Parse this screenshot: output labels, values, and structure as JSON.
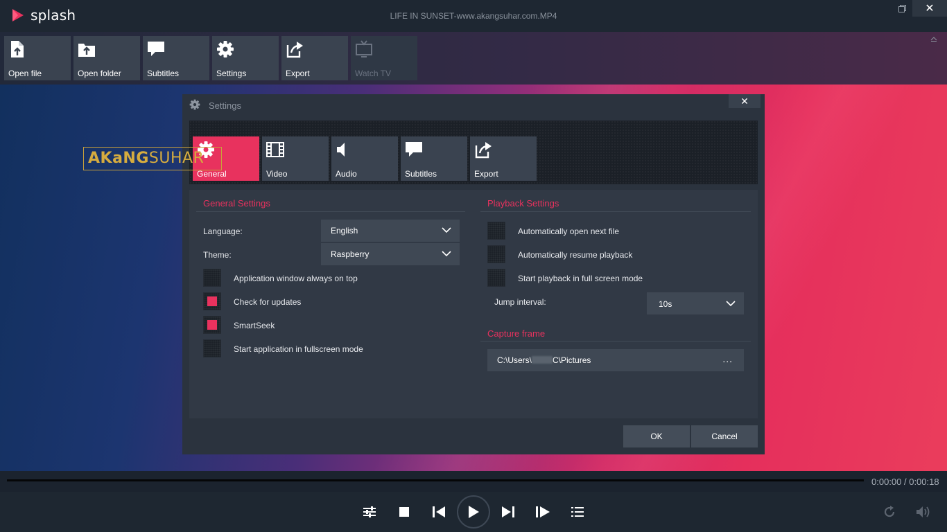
{
  "app": {
    "name": "splash",
    "file_title": "LIFE IN SUNSET-www.akangsuhar.com.MP4"
  },
  "window_controls": {
    "close_glyph": "✕"
  },
  "toolbar": {
    "items": [
      {
        "label": "Open file",
        "icon": "open-file-icon"
      },
      {
        "label": "Open folder",
        "icon": "open-folder-icon"
      },
      {
        "label": "Subtitles",
        "icon": "subtitles-icon"
      },
      {
        "label": "Settings",
        "icon": "gear-icon"
      },
      {
        "label": "Export",
        "icon": "export-icon"
      },
      {
        "label": "Watch TV",
        "icon": "tv-icon",
        "disabled": true
      }
    ]
  },
  "watermark": {
    "bold": "AKaNG",
    "thin": "SUHAR"
  },
  "dialog": {
    "title": "Settings",
    "close_glyph": "✕",
    "tabs": [
      {
        "label": "General",
        "icon": "gear-icon",
        "active": true
      },
      {
        "label": "Video",
        "icon": "film-icon"
      },
      {
        "label": "Audio",
        "icon": "speaker-icon"
      },
      {
        "label": "Subtitles",
        "icon": "subtitles-icon"
      },
      {
        "label": "Export",
        "icon": "export-icon"
      }
    ],
    "general": {
      "title": "General Settings",
      "language_label": "Language:",
      "language_value": "English",
      "theme_label": "Theme:",
      "theme_value": "Raspberry",
      "checkboxes": [
        {
          "label": "Application window always on top",
          "checked": false
        },
        {
          "label": "Check for updates",
          "checked": true
        },
        {
          "label": "SmartSeek",
          "checked": true
        },
        {
          "label": "Start application in fullscreen mode",
          "checked": false
        }
      ]
    },
    "playback": {
      "title": "Playback Settings",
      "checkboxes": [
        {
          "label": "Automatically open next file",
          "checked": false
        },
        {
          "label": "Automatically resume playback",
          "checked": false
        },
        {
          "label": "Start playback in full screen mode",
          "checked": false
        }
      ],
      "jump_label": "Jump interval:",
      "jump_value": "10s"
    },
    "capture": {
      "title": "Capture frame",
      "path_start": "C:\\Users\\",
      "path_end": "C\\Pictures",
      "browse": "..."
    },
    "ok": "OK",
    "cancel": "Cancel"
  },
  "player": {
    "time": "0:00:00 / 0:00:18",
    "progress": 0
  },
  "colors": {
    "accent": "#e8325e",
    "panel": "#313945",
    "button": "#3a4350"
  }
}
